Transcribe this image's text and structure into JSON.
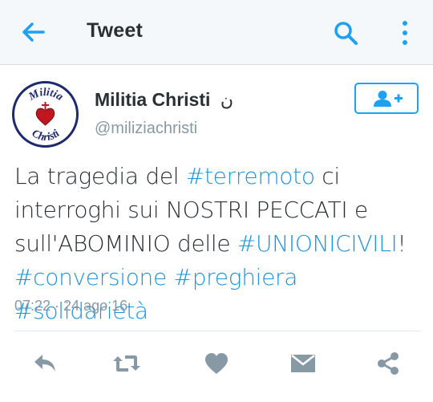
{
  "appbar": {
    "title": "Tweet",
    "icons": {
      "back": "arrow-left-icon",
      "search": "search-icon",
      "menu": "more-vertical-icon"
    },
    "accent": "#1da1f2"
  },
  "tweet": {
    "author": {
      "display_name": "Militia Christi",
      "name_suffix": "ن",
      "handle": "@miliziachristi",
      "avatar_text_top": "Militia",
      "avatar_text_bottom": "Christi"
    },
    "follow_icon": "add-user-icon",
    "text": {
      "p1": "La tragedia del ",
      "h1": "#terremoto",
      "p2": " ci interroghi sui NOSTRI PECCATI e sull'ABOMINIO delle ",
      "h2": "#UNIONICIVILI",
      "p3": "! ",
      "h3": "#conversione",
      "h4": "#preghiera",
      "h5": "#solidarietà"
    },
    "timestamp": "07:22 · 24 ago 16"
  },
  "actions": [
    "reply-icon",
    "retweet-icon",
    "like-icon",
    "message-icon",
    "share-icon"
  ],
  "colors": {
    "text": "#292f33",
    "muted": "#8899a6",
    "link": "#1b95e0",
    "icon": "#8899a6"
  }
}
